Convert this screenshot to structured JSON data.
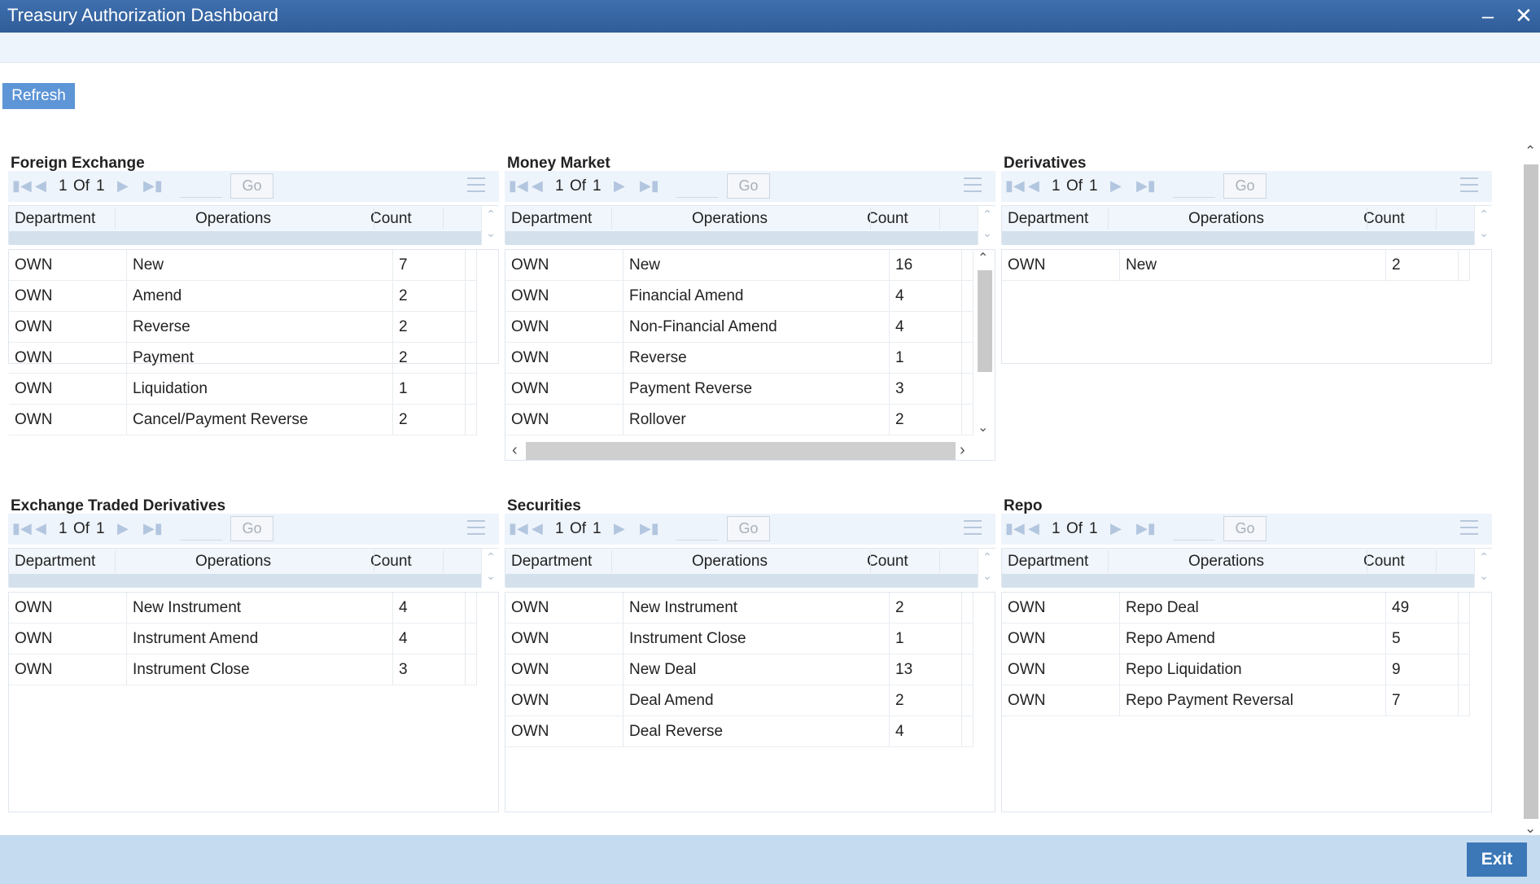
{
  "window": {
    "title": "Treasury Authorization Dashboard",
    "minimize": "‒",
    "close": "✕"
  },
  "toolbar": {
    "refresh_label": "Refresh"
  },
  "columns": {
    "department": "Department",
    "operations": "Operations",
    "count": "Count"
  },
  "pager": {
    "page": "1",
    "of_label": "Of",
    "total": "1",
    "go_label": "Go"
  },
  "panels": [
    {
      "title": "Foreign Exchange",
      "rows": [
        [
          "OWN",
          "New",
          "7"
        ],
        [
          "OWN",
          "Amend",
          "2"
        ],
        [
          "OWN",
          "Reverse",
          "2"
        ],
        [
          "OWN",
          "Payment",
          "2"
        ],
        [
          "OWN",
          "Liquidation",
          "1"
        ],
        [
          "OWN",
          "Cancel/Payment Reverse",
          "2"
        ]
      ]
    },
    {
      "title": "Money Market",
      "rows": [
        [
          "OWN",
          "New",
          "16"
        ],
        [
          "OWN",
          "Financial Amend",
          "4"
        ],
        [
          "OWN",
          "Non-Financial Amend",
          "4"
        ],
        [
          "OWN",
          "Reverse",
          "1"
        ],
        [
          "OWN",
          "Payment Reverse",
          "3"
        ],
        [
          "OWN",
          "Rollover",
          "2"
        ]
      ]
    },
    {
      "title": "Derivatives",
      "rows": [
        [
          "OWN",
          "New",
          "2"
        ]
      ]
    },
    {
      "title": "Exchange Traded Derivatives",
      "rows": [
        [
          "OWN",
          "New Instrument",
          "4"
        ],
        [
          "OWN",
          "Instrument Amend",
          "4"
        ],
        [
          "OWN",
          "Instrument Close",
          "3"
        ]
      ]
    },
    {
      "title": "Securities",
      "rows": [
        [
          "OWN",
          "New Instrument",
          "2"
        ],
        [
          "OWN",
          "Instrument Close",
          "1"
        ],
        [
          "OWN",
          "New Deal",
          "13"
        ],
        [
          "OWN",
          "Deal Amend",
          "2"
        ],
        [
          "OWN",
          "Deal Reverse",
          "4"
        ]
      ]
    },
    {
      "title": "Repo",
      "rows": [
        [
          "OWN",
          "Repo Deal",
          "49"
        ],
        [
          "OWN",
          "Repo Amend",
          "5"
        ],
        [
          "OWN",
          "Repo Liquidation",
          "9"
        ],
        [
          "OWN",
          "Repo Payment Reversal",
          "7"
        ]
      ]
    }
  ],
  "footer": {
    "exit_label": "Exit"
  },
  "colors": {
    "titlebar": "#2f5d99",
    "refresh": "#5d95d6",
    "exit": "#3c78b8",
    "footer": "#c5dbef"
  }
}
